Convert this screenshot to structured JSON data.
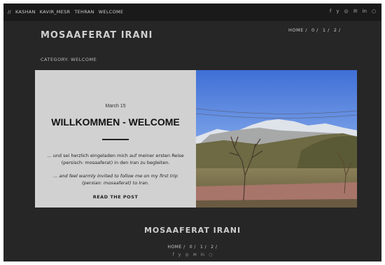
{
  "top_nav": {
    "slashes": "//",
    "items": [
      "KASHAN",
      "KAVIR_MESR",
      "TEHRAN",
      "WELCOME"
    ]
  },
  "social_icons": [
    "facebook-icon",
    "twitter-icon",
    "instagram-icon",
    "email-icon",
    "linkedin-icon",
    "github-icon"
  ],
  "social_glyphs": [
    "f",
    "y",
    "◎",
    "✉",
    "in",
    "○"
  ],
  "site": {
    "title": "MOSAAFERAT IRANI"
  },
  "breadcrumb": [
    "HOME /",
    "0 /",
    "1 /",
    "2 /"
  ],
  "category": "CATEGORY: WELCOME",
  "post": {
    "date": "March 15",
    "title": "WILLKOMMEN - WELCOME",
    "excerpt_de": "... und sei herzlich eingeladen mich auf meiner ersten Reise (persisch: mosaaferat) in den Iran zu begleiten.",
    "excerpt_en": "... and feel warmly invited to follow me on my first trip (persian: mosaaferat) to Iran.",
    "read_more": "READ THE POST"
  },
  "footer": {
    "title": "MOSAAFERAT IRANI",
    "breadcrumb": [
      "HOME /",
      "0 /",
      "1 /",
      "2 /"
    ]
  },
  "colors": {
    "background": "#262626",
    "topbar": "#1a1a1a",
    "card_text_bg": "#d1d1d1"
  }
}
